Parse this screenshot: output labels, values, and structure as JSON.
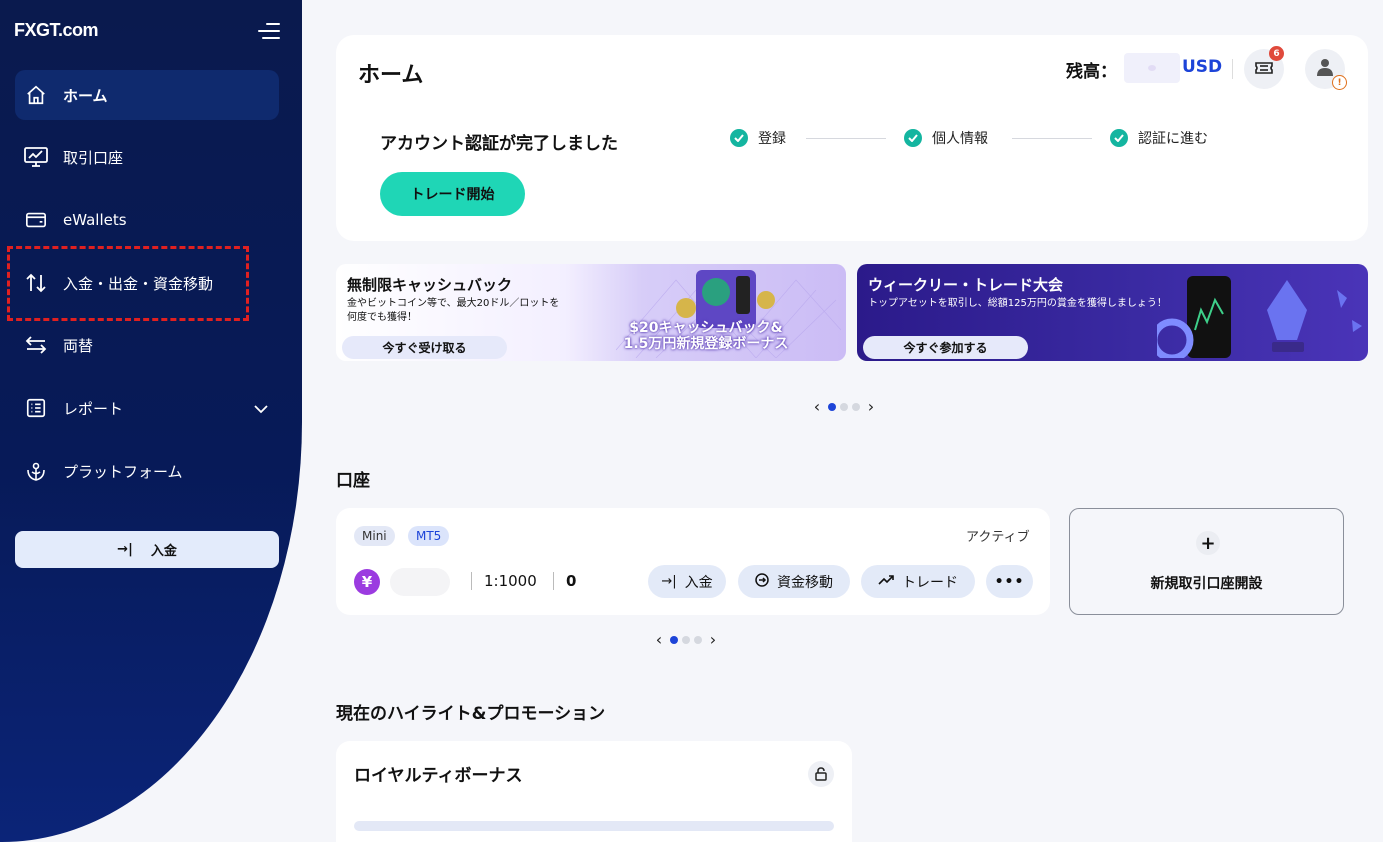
{
  "brand": {
    "logo": "FXGT.com"
  },
  "sidebar": {
    "items": [
      {
        "label": "ホーム",
        "icon": "home-icon",
        "active": true
      },
      {
        "label": "取引口座",
        "icon": "chart-monitor-icon"
      },
      {
        "label": "eWallets",
        "icon": "wallet-icon"
      },
      {
        "label": "入金・出金・資金移動",
        "icon": "transfer-arrows-icon"
      },
      {
        "label": "両替",
        "icon": "exchange-icon"
      },
      {
        "label": "レポート",
        "icon": "report-list-icon",
        "expandable": true
      },
      {
        "label": "プラットフォーム",
        "icon": "platform-icon"
      }
    ],
    "deposit_button": "入金"
  },
  "header": {
    "title": "ホーム",
    "balance_label": "残高：",
    "currency": "USD",
    "notifications_count": "6"
  },
  "verification": {
    "title": "アカウント認証が完了しました",
    "steps": [
      "登録",
      "個人情報",
      "認証に進む"
    ],
    "trade_button": "トレード開始"
  },
  "banners": [
    {
      "title": "無制限キャッシュバック",
      "subtitle_line1": "金やビットコイン等で、最大20ドル／ロットを",
      "subtitle_line2": "何度でも獲得！",
      "button": "今すぐ受け取る",
      "art_line1": "$20キャッシュバック&",
      "art_line2": "1.5万円新規登録ボーナス"
    },
    {
      "title": "ウィークリー・トレード大会",
      "subtitle_line1": "トップアセットを取引し、総額125万円の賞金を獲得しましょう！",
      "button": "今すぐ参加する"
    }
  ],
  "accounts": {
    "section_title": "口座",
    "card": {
      "tags": [
        "Mini",
        "MT5"
      ],
      "status": "アクティブ",
      "currency_symbol": "¥",
      "leverage": "1:1000",
      "balance": "0",
      "actions": [
        "入金",
        "資金移動",
        "トレード"
      ],
      "more": "•••"
    },
    "new_account": "新規取引口座開設"
  },
  "promotions": {
    "section_title": "現在のハイライト&プロモーション",
    "loyalty_title": "ロイヤルティボーナス"
  },
  "colors": {
    "sidebar_bg": "#0a1a4e",
    "accent_blue": "#1d44d8",
    "teal": "#1fd6b6",
    "badge_red": "#e04a3c"
  }
}
